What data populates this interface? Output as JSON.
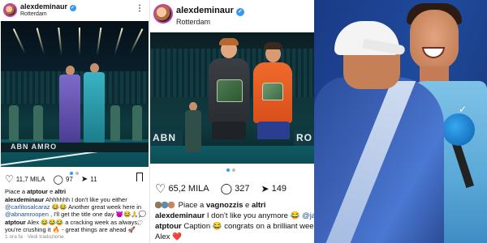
{
  "post1": {
    "username": "alexdeminaur",
    "location": "Rotterdam",
    "likes": "11,7 MILA",
    "comments": "97",
    "shares": "11",
    "liked_by_prefix": "Piace a",
    "liked_by_user": "atptour",
    "liked_by_and": "e",
    "liked_by_others": "altri",
    "caption_user": "alexdeminaur",
    "caption_line1": "Ahhhhhh I don't like you either",
    "caption_line2_mention": "@carlitosalcaraz",
    "caption_line2_rest": "😂😂 Another great week here in",
    "caption_line3_mention": "@abnamroopen",
    "caption_line3_rest": ", I'll get the title one day 😈😂🙏💭",
    "comment_user": "atptour",
    "comment_line1": "Alex 😂😂😂 a cracking week as always,",
    "comment_line2": "you're crushing it 🔥 - great things are ahead 🚀",
    "meta_time": "1 ora fa",
    "meta_translate": "Vedi traduzione",
    "photo_banner": "ABN AMRO"
  },
  "post2": {
    "username": "alexdeminaur",
    "location": "Rotterdam",
    "likes": "65,2 MILA",
    "comments": "327",
    "shares": "149",
    "liked_by_prefix": "Piace a",
    "liked_by_user": "vagnozzis",
    "liked_by_and": "e",
    "liked_by_others": "altri",
    "caption_user": "alexdeminaur",
    "caption_text": "I don't like you anymore 😂",
    "caption_mention": "@jar",
    "comment_user": "atptour",
    "comment_text": "Caption 😂 congrats on a brilliant wee",
    "comment_line2": "Alex ❤️",
    "photo_banner_left": "ABN",
    "photo_banner_right": "RO"
  },
  "icons": {
    "heart": "♡",
    "comment": "💬",
    "share": "➤",
    "bookmark": "⌑",
    "more": "⋮",
    "small_heart": "♡"
  },
  "colors": {
    "verified": "#3897f0",
    "mention": "#1f4f8a",
    "atp_blue": "#1b3f8a"
  }
}
